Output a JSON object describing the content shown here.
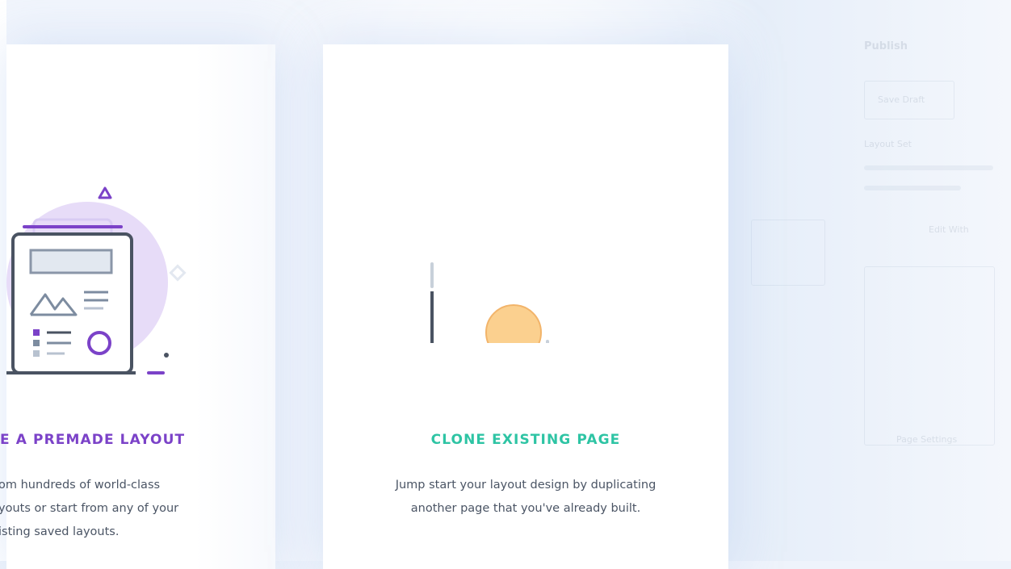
{
  "cards": [
    {
      "id": "premade",
      "title": "E A PREMADE LAYOUT",
      "description_lines": [
        "om hundreds of world-class",
        "youts or start from any of your",
        "isting saved layouts."
      ]
    },
    {
      "id": "clone",
      "title": "CLONE EXISTING PAGE",
      "description_lines": [
        "Jump start your layout design by duplicating",
        "another page that you've already built."
      ]
    }
  ],
  "background_ui": {
    "label_top": "Publish",
    "button_label": "Save Draft",
    "text_1": "Layout Set",
    "text_2": "Edit With",
    "text_3": "Page Settings"
  },
  "colors": {
    "premade_accent": "#7b42c8",
    "clone_accent": "#2ec4a4",
    "body_text": "#4b5565",
    "illustration_dark": "#4a5362",
    "illustration_orange": "#fbd08f",
    "illustration_purple_light": "#e7dcf8"
  },
  "icons": {
    "premade_illustration": "layout-document-icon",
    "clone_illustration": "clone-chart-icon"
  }
}
